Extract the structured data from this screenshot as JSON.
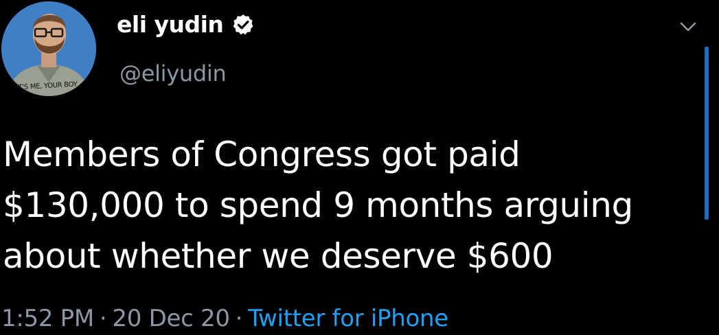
{
  "user": {
    "display_name": "eli yudin",
    "handle": "@eliyudin",
    "verified": true,
    "avatar_caption": "IT'S ME, YOUR BOY"
  },
  "tweet": {
    "lines": [
      "Members of Congress got paid",
      "$130,000 to spend 9 months arguing",
      "about whether we deserve $600"
    ]
  },
  "meta": {
    "time": "1:52 PM",
    "separator": "·",
    "date": "20 Dec 20",
    "source": "Twitter for iPhone"
  },
  "icons": {
    "verified": "verified-badge-icon",
    "menu": "chevron-down-icon"
  },
  "colors": {
    "background": "#000000",
    "text_primary": "#ffffff",
    "text_secondary": "#8b98a5",
    "link": "#1da1f2",
    "avatar_bg": "#3f7fc4",
    "scroll_indicator": "#1e6cbd"
  }
}
